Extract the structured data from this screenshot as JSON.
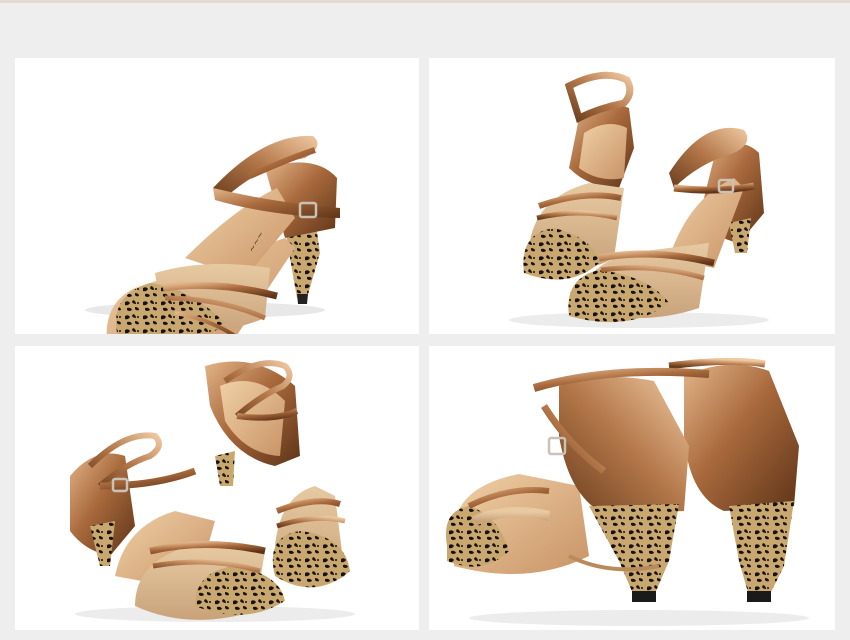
{
  "caption": {
    "lines": [
      "",
      "",
      ""
    ]
  },
  "colors": {
    "background": "#eeeeee",
    "panel": "#ffffff",
    "bronze_light": "#d7a574",
    "bronze_mid": "#a8693c",
    "bronze_dark": "#5e3418",
    "gold_mesh": "#d9b58c",
    "insole": "#e3b98c",
    "leopard_base": "#c8a56e",
    "leopard_spot": "#1a1210"
  },
  "panels": [
    {
      "name": "photo-shoe-side-view",
      "icon": "shoe-photo"
    },
    {
      "name": "photo-shoe-pair-front",
      "icon": "shoe-photo"
    },
    {
      "name": "photo-shoe-pair-angle",
      "icon": "shoe-photo"
    },
    {
      "name": "photo-shoe-pair-back",
      "icon": "shoe-photo"
    }
  ]
}
